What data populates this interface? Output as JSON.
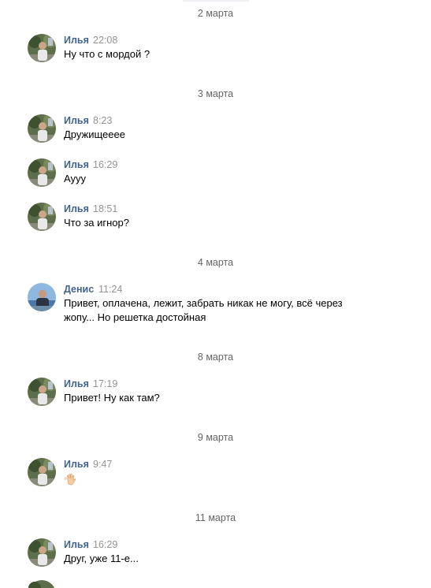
{
  "dates": [
    "2 марта",
    "3 марта",
    "4 марта",
    "8 марта",
    "9 марта",
    "11 марта"
  ],
  "messages": [
    {
      "author": "Илья",
      "time": "22:08",
      "text": "Ну что с мордой ?",
      "avatar": "avatar-ilya"
    },
    {
      "author": "Илья",
      "time": "8:23",
      "text": "Дружищеееe",
      "avatar": "avatar-ilya"
    },
    {
      "author": "Илья",
      "time": "16:29",
      "text": "Аууу",
      "avatar": "avatar-ilya"
    },
    {
      "author": "Илья",
      "time": "18:51",
      "text": "Что за игнор?",
      "avatar": "avatar-ilya"
    },
    {
      "author": "Денис",
      "time": "11:24",
      "text": "Привет, оплачена, лежит, забрать никак не могу, всё через",
      "text2": "жопу... Но решетка достойная",
      "avatar": "avatar-denis"
    },
    {
      "author": "Илья",
      "time": "17:19",
      "text": "Привет! Ну как там?",
      "avatar": "avatar-ilya"
    },
    {
      "author": "Илья",
      "time": "9:47",
      "emoji": "waving-hand-icon",
      "avatar": "avatar-ilya"
    },
    {
      "author": "Илья",
      "time": "16:29",
      "text": "Друг, уже 11-е...",
      "avatar": "avatar-ilya"
    }
  ],
  "colors": {
    "author": "#42648b",
    "time": "#939393",
    "date": "#656565",
    "text": "#000000"
  }
}
